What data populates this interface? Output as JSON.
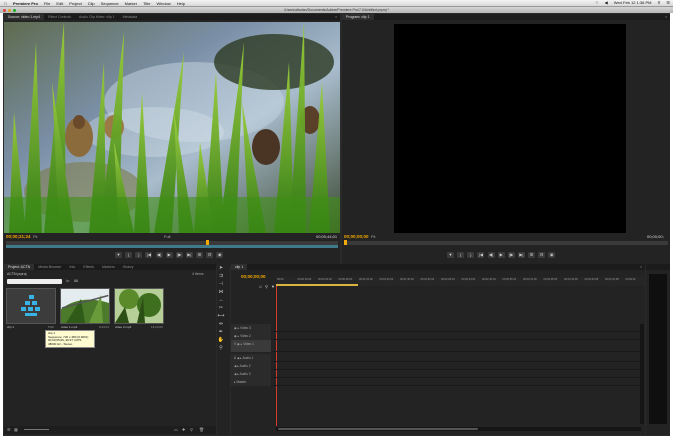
{
  "menubar": {
    "apple": "",
    "app_name": "Premiere Pro",
    "items": [
      "File",
      "Edit",
      "Project",
      "Clip",
      "Sequence",
      "Marker",
      "Title",
      "Window",
      "Help"
    ],
    "clock": "Wed Feb 12  1:36 PM"
  },
  "window": {
    "title": "/Users/altodan/Documents/Adobe/Premiere Pro/7.0/Untitled.prproj *"
  },
  "source_monitor": {
    "tabs": [
      "Source: video 1.mp4",
      "Effect Controls",
      "Audio Clip Mixer: clip 1",
      "Metadata"
    ],
    "timecode_in": "00;00;21;24",
    "fit": "Fit",
    "timecode_duration": "00;00;44;01",
    "resolution": "Full"
  },
  "program_monitor": {
    "tabs": [
      "Program: clip 1"
    ],
    "timecode_in": "00;00;00;00",
    "fit": "Fit",
    "timecode_duration": "00;00;00;"
  },
  "project_panel": {
    "tabs": [
      "Project: ACTN",
      "Media Browser",
      "Info",
      "Effects",
      "Markers",
      "History"
    ],
    "project_file": "ACTN.prproj",
    "item_count": "4 Items",
    "in_label": "In:",
    "in_value": "All",
    "items": [
      {
        "name": "clip 1",
        "duration": "5;00"
      },
      {
        "name": "video 1.mp4",
        "duration": "0;44;01"
      },
      {
        "name": "video 2.mp4",
        "duration": "13;23;00"
      }
    ],
    "tooltip": [
      "clip 1",
      "Sequence, 720 x 480 (0.9091)",
      "00;00;05;00, 29.97 i-FPS",
      "48000 Hz - Stereo"
    ]
  },
  "timeline": {
    "tabs": [
      "clip 1"
    ],
    "timecode": "00;00;00;00",
    "ruler": [
      "00;00",
      "00;00;16;00",
      "00;00;32;00",
      "00;00;48;00",
      "00;01;04;02",
      "00;01;20;02",
      "00;01;36;02",
      "00;01;52;02",
      "00;02;08;04",
      "00;02;24;04",
      "00;02;40;04",
      "00;02;56;04",
      "00;03;12;06",
      "00;03;28;06",
      "00;03;44;06",
      "00;04;00;08",
      "00;04;16;08",
      "00;04;32"
    ],
    "video_tracks": [
      "Video 3",
      "Video 2",
      "Video 1"
    ],
    "audio_tracks": [
      "Audio 1",
      "Audio 2",
      "Audio 3",
      "Master"
    ],
    "track_prefix_v": "V",
    "track_prefix_a": "A"
  },
  "colors": {
    "accent_timecode": "#f2a900",
    "work_area": "#d9b440",
    "playhead": "#d83a2a",
    "panel_bg": "#232323"
  }
}
